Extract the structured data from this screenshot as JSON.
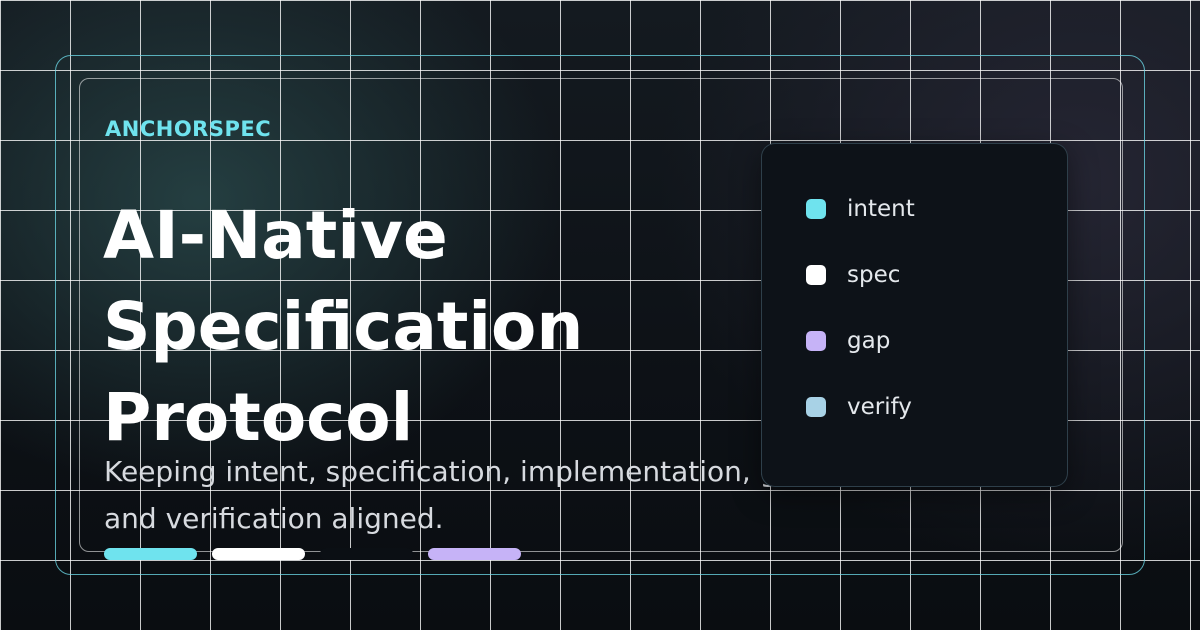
{
  "brand": "ANCHORSPEC",
  "title": {
    "lines": [
      "AI-Native",
      "Specification",
      "Protocol"
    ]
  },
  "subtitle": "Keeping intent, specification, implementation, gaps, and verification aligned.",
  "legend": {
    "items": [
      {
        "label": "intent",
        "color": "#6fe3ee"
      },
      {
        "label": "spec",
        "color": "#ffffff"
      },
      {
        "label": "gap",
        "color": "#c6b3f7"
      },
      {
        "label": "verify",
        "color": "#a8d2e6"
      }
    ]
  },
  "accent_bars": [
    {
      "color": "#6fe3ee"
    },
    {
      "color": "#ffffff"
    },
    {
      "color": "#0b0f14"
    },
    {
      "color": "#c6b3f7"
    }
  ],
  "colors": {
    "accent": "#6fe3ee",
    "background": "#0b0f14",
    "frame": "#6fdceb"
  }
}
